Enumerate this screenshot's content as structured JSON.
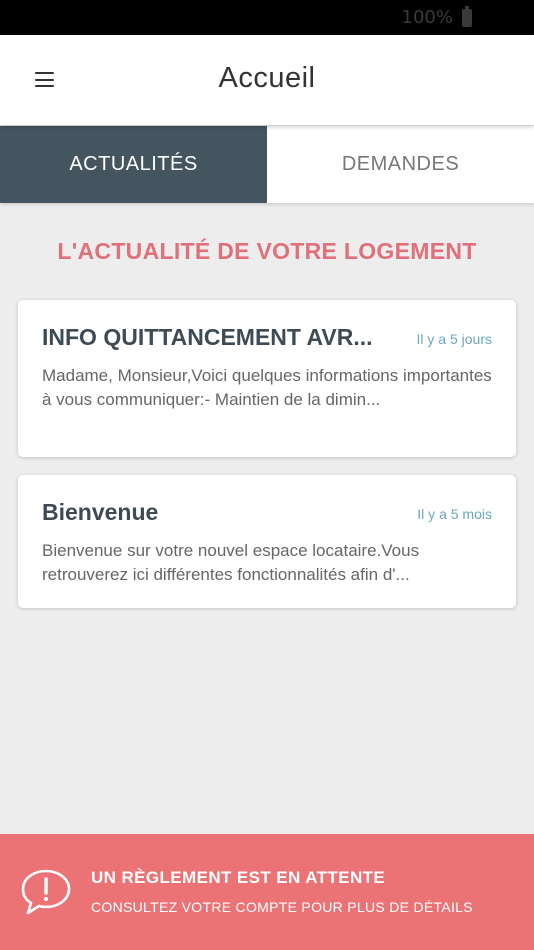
{
  "status_bar": {
    "battery_text": "100%"
  },
  "header": {
    "title": "Accueil"
  },
  "tabs": [
    {
      "label": "ACTUALITÉS",
      "active": true
    },
    {
      "label": "DEMANDES",
      "active": false
    }
  ],
  "section": {
    "title": "L'ACTUALITÉ DE VOTRE LOGEMENT"
  },
  "news": [
    {
      "title": "INFO QUITTANCEMENT AVR...",
      "time": "Il y a 5 jours",
      "excerpt": "Madame, Monsieur,Voici quelques informations importantes à vous communiquer:- Maintien de la dimin..."
    },
    {
      "title": "Bienvenue",
      "time": "Il y a 5 mois",
      "excerpt": "Bienvenue sur votre nouvel espace locataire.Vous retrouverez ici différentes fonctionnalités afin d'..."
    }
  ],
  "banner": {
    "title": "UN RÈGLEMENT EST EN ATTENTE",
    "subtitle": "CONSULTEZ VOTRE COMPTE POUR PLUS DE DÉTAILS"
  },
  "colors": {
    "tab_active": "#455560",
    "accent_red": "#e0707a",
    "banner_bg": "#eb7376",
    "time_blue": "#6aa7c0"
  }
}
